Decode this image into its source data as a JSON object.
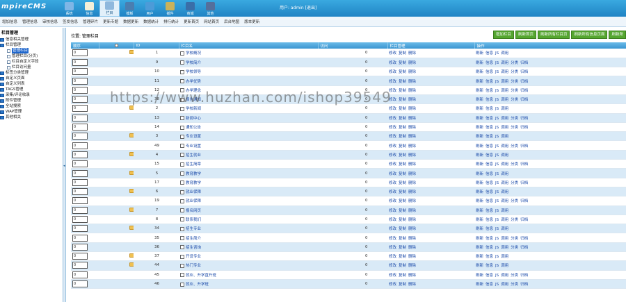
{
  "header": {
    "logo": "mpireCMS",
    "nav": [
      {
        "label": "系统",
        "color": "#7fb6e6",
        "active": false
      },
      {
        "label": "信息",
        "color": "#f4f0d8",
        "active": false
      },
      {
        "label": "栏目",
        "color": "#8fb8dd",
        "active": true
      },
      {
        "label": "模板",
        "color": "#4a7eb0",
        "active": false
      },
      {
        "label": "用户",
        "color": "#4c9bd8",
        "active": false
      },
      {
        "label": "插件",
        "color": "#c9b25a",
        "active": false
      },
      {
        "label": "商城",
        "color": "#3a6ea8",
        "active": false
      },
      {
        "label": "其他",
        "color": "#556f9b",
        "active": false
      }
    ],
    "user_info": "用户: admin [退出]"
  },
  "submenu": [
    "增加信息",
    "管理信息",
    "审核信息",
    "签发信息",
    "管理碎片",
    "更新专题",
    "数据更新",
    "数据统计",
    "排行统计",
    "更新首页",
    "网站首页",
    "后台地图",
    "版本更新"
  ],
  "sidebar": {
    "title": "栏目管理",
    "items": [
      {
        "label": "信息相关管理",
        "type": "folder",
        "level": 1,
        "selected": false
      },
      {
        "label": "栏目管理",
        "type": "folder",
        "level": 1,
        "selected": false
      },
      {
        "label": "管理栏目",
        "type": "file",
        "level": 3,
        "selected": true
      },
      {
        "label": "管理栏目(分页)",
        "type": "file",
        "level": 3,
        "selected": false
      },
      {
        "label": "栏目自定义字段",
        "type": "file",
        "level": 3,
        "selected": false
      },
      {
        "label": "栏目访问量",
        "type": "file",
        "level": 3,
        "selected": false
      },
      {
        "label": "标签分类管理",
        "type": "folder",
        "level": 1,
        "selected": false
      },
      {
        "label": "自定义页面",
        "type": "folder",
        "level": 1,
        "selected": false
      },
      {
        "label": "自定义列表",
        "type": "folder",
        "level": 1,
        "selected": false
      },
      {
        "label": "TAGS管理",
        "type": "folder",
        "level": 1,
        "selected": false
      },
      {
        "label": "采集/评论收录",
        "type": "folder",
        "level": 1,
        "selected": false
      },
      {
        "label": "附件管理",
        "type": "folder",
        "level": 1,
        "selected": false
      },
      {
        "label": "全站搜索",
        "type": "folder",
        "level": 1,
        "selected": false
      },
      {
        "label": "WAP管理",
        "type": "folder",
        "level": 1,
        "selected": false
      },
      {
        "label": "其他相关",
        "type": "folder",
        "level": 1,
        "selected": false
      }
    ]
  },
  "main": {
    "location": "位置: 管理栏目",
    "buttons": [
      "增加栏目",
      "刷新首页",
      "刷新所有栏目页",
      "刷新所有信息页面",
      "刷新所"
    ],
    "columns": [
      "顺序",
      "",
      "ID",
      "栏目名",
      "访问",
      "栏目管理",
      "操作"
    ],
    "col_mgmt_links": [
      "修改",
      "复制",
      "删除"
    ],
    "op_links_full": [
      "刷新",
      "信息",
      "JS",
      "调用",
      "分类",
      "归档"
    ],
    "op_links_short": [
      "刷新",
      "信息",
      "JS",
      "调用"
    ],
    "rows": [
      {
        "order": "0",
        "icon": "folder",
        "id": "1",
        "name": "学校概况",
        "visits": "0",
        "ops": "short"
      },
      {
        "order": "0",
        "icon": "doc",
        "id": "9",
        "name": "学校简介",
        "visits": "0",
        "ops": "full"
      },
      {
        "order": "0",
        "icon": "doc",
        "id": "10",
        "name": "学校领导",
        "visits": "0",
        "ops": "full"
      },
      {
        "order": "0",
        "icon": "doc",
        "id": "11",
        "name": "办学优势",
        "visits": "0",
        "ops": "full"
      },
      {
        "order": "0",
        "icon": "doc",
        "id": "12",
        "name": "办学理念",
        "visits": "0",
        "ops": "full"
      },
      {
        "order": "0",
        "icon": "doc",
        "id": "38",
        "name": "报告通知",
        "visits": "0",
        "ops": "full"
      },
      {
        "order": "0",
        "icon": "folder",
        "id": "2",
        "name": "学校新闻",
        "visits": "0",
        "ops": "short"
      },
      {
        "order": "0",
        "icon": "doc",
        "id": "13",
        "name": "新闻中心",
        "visits": "0",
        "ops": "full"
      },
      {
        "order": "0",
        "icon": "doc",
        "id": "14",
        "name": "通知公告",
        "visits": "0",
        "ops": "full"
      },
      {
        "order": "0",
        "icon": "folder",
        "id": "3",
        "name": "专业设置",
        "visits": "0",
        "ops": "short"
      },
      {
        "order": "0",
        "icon": "doc",
        "id": "49",
        "name": "专业设置",
        "visits": "0",
        "ops": "full"
      },
      {
        "order": "0",
        "icon": "folder",
        "id": "4",
        "name": "招生就业",
        "visits": "0",
        "ops": "short"
      },
      {
        "order": "0",
        "icon": "doc",
        "id": "15",
        "name": "招生简章",
        "visits": "0",
        "ops": "full"
      },
      {
        "order": "0",
        "icon": "folder",
        "id": "5",
        "name": "教育教学",
        "visits": "0",
        "ops": "short"
      },
      {
        "order": "0",
        "icon": "doc",
        "id": "17",
        "name": "教育教学",
        "visits": "0",
        "ops": "full"
      },
      {
        "order": "0",
        "icon": "folder",
        "id": "6",
        "name": "就业保障",
        "visits": "0",
        "ops": "short"
      },
      {
        "order": "0",
        "icon": "doc",
        "id": "19",
        "name": "就业保障",
        "visits": "0",
        "ops": "full"
      },
      {
        "order": "0",
        "icon": "folder",
        "id": "7",
        "name": "报名网页",
        "visits": "0",
        "ops": "short"
      },
      {
        "order": "0",
        "icon": "doc",
        "id": "8",
        "name": "联系我们",
        "visits": "0",
        "ops": "full"
      },
      {
        "order": "0",
        "icon": "folder",
        "id": "34",
        "name": "招生专业",
        "visits": "0",
        "ops": "short"
      },
      {
        "order": "0",
        "icon": "doc",
        "id": "35",
        "name": "招生简介",
        "visits": "0",
        "ops": "full"
      },
      {
        "order": "0",
        "icon": "doc",
        "id": "36",
        "name": "招生咨询",
        "visits": "0",
        "ops": "full"
      },
      {
        "order": "0",
        "icon": "folder",
        "id": "37",
        "name": "开设专业",
        "visits": "0",
        "ops": "short"
      },
      {
        "order": "0",
        "icon": "folder",
        "id": "44",
        "name": "热门专业",
        "visits": "0",
        "ops": "short"
      },
      {
        "order": "0",
        "icon": "doc",
        "id": "45",
        "name": "就业、升学直升班",
        "visits": "0",
        "ops": "full"
      },
      {
        "order": "0",
        "icon": "doc",
        "id": "46",
        "name": "就业、升学班",
        "visits": "0",
        "ops": "full"
      }
    ]
  },
  "watermark": "https://www.huzhan.com/ishop39549"
}
